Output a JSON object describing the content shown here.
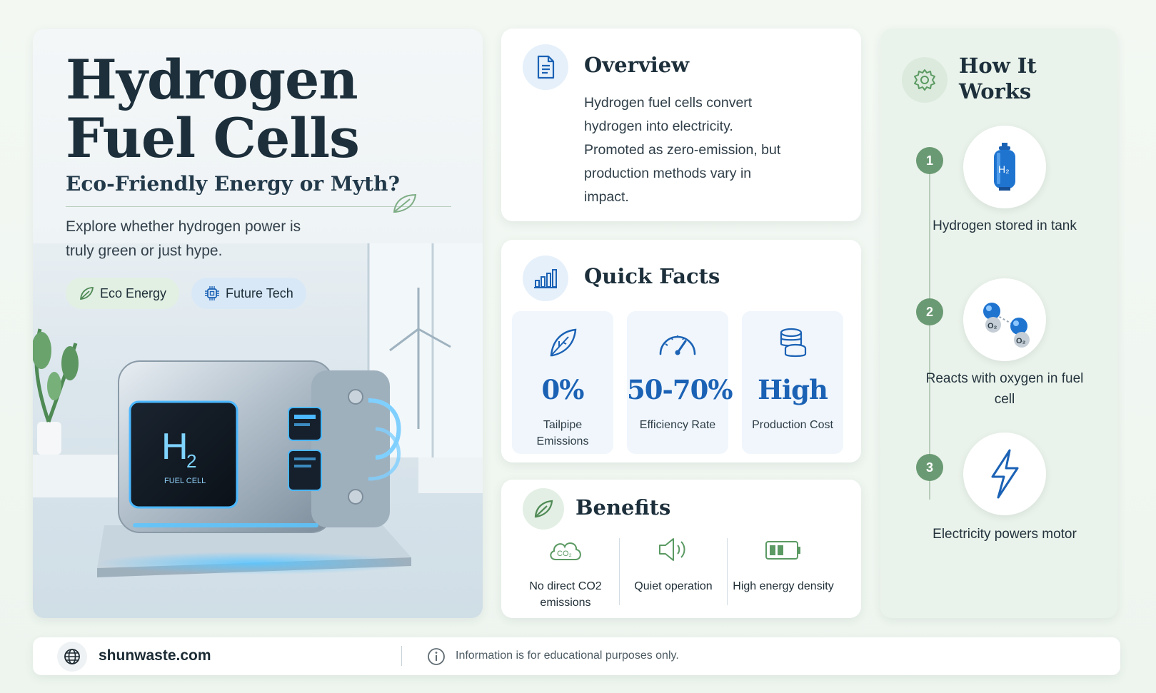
{
  "hero": {
    "title_line1": "Hydrogen",
    "title_line2": "Fuel Cells",
    "subtitle": "Eco-Friendly Energy or Myth?",
    "description": "Explore whether hydrogen power is truly green or just hype.",
    "tags": [
      {
        "label": "Eco Energy",
        "icon": "leaf-icon"
      },
      {
        "label": "Future Tech",
        "icon": "chip-icon"
      }
    ],
    "device": {
      "symbol": "H",
      "subscript": "2",
      "caption": "FUEL CELL"
    }
  },
  "overview": {
    "title": "Overview",
    "icon": "document-icon",
    "text": "Hydrogen fuel cells convert hydrogen into electricity. Promoted as zero-emission, but production methods vary in impact."
  },
  "quick_facts": {
    "title": "Quick Facts",
    "icon": "bar-chart-icon",
    "items": [
      {
        "value": "0%",
        "label": "Tailpipe Emissions",
        "icon": "leaf-icon"
      },
      {
        "value": "50-70%",
        "label": "Efficiency Rate",
        "icon": "gauge-icon"
      },
      {
        "value": "High",
        "label": "Production Cost",
        "icon": "coins-icon"
      }
    ]
  },
  "benefits": {
    "title": "Benefits",
    "icon": "leaf-icon",
    "items": [
      {
        "label": "No direct CO2 emissions",
        "icon": "co2-cloud-icon",
        "icon_text": "CO₂"
      },
      {
        "label": "Quiet operation",
        "icon": "speaker-icon"
      },
      {
        "label": "High energy density",
        "icon": "battery-icon"
      }
    ]
  },
  "how_it_works": {
    "title_line1": "How It",
    "title_line2": "Works",
    "icon": "gear-icon",
    "steps": [
      {
        "number": "1",
        "label": "Hydrogen stored in tank",
        "icon": "hydrogen-tank-icon",
        "icon_text": "H₂"
      },
      {
        "number": "2",
        "label": "Reacts with oxygen in fuel cell",
        "icon": "molecule-icon",
        "icon_text": "O₂"
      },
      {
        "number": "3",
        "label": "Electricity powers motor",
        "icon": "lightning-icon"
      }
    ]
  },
  "footer": {
    "site": "shunwaste.com",
    "note": "Information is for educational purposes only.",
    "icons": [
      "globe-icon",
      "info-icon"
    ]
  },
  "colors": {
    "accent_blue": "#1b62b5",
    "accent_green": "#6a9a73",
    "heading": "#1c2f3b"
  }
}
